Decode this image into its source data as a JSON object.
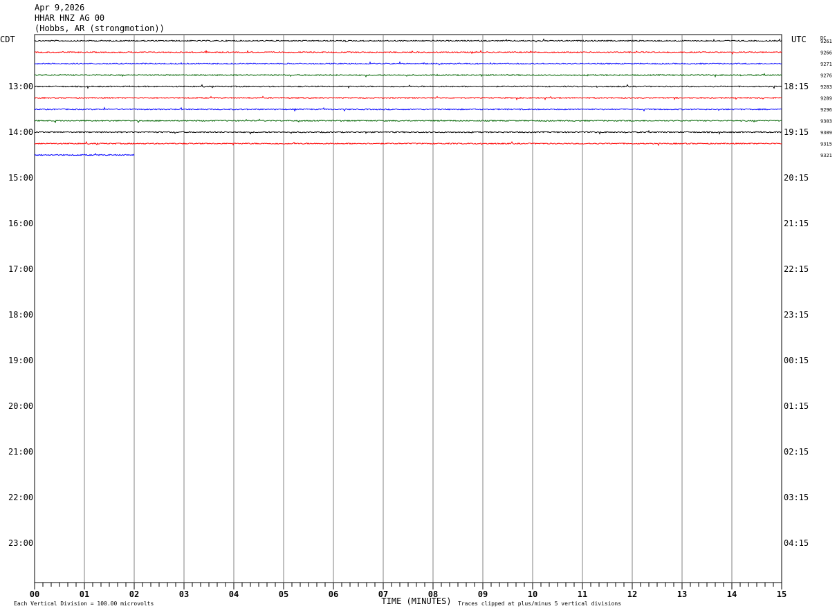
{
  "header": {
    "date": "Apr 9,2026",
    "station": "HHAR HNZ AG 00",
    "location": "(Hobbs, AR (strongmotion))"
  },
  "chart_data": {
    "type": "line",
    "left_axis_label": "CDT",
    "right_axis_label": "UTC",
    "dc_label": "DC",
    "xlabel": "TIME (MINUTES)",
    "xlim": [
      0,
      15
    ],
    "x_tick_labels": [
      "00",
      "01",
      "02",
      "03",
      "04",
      "05",
      "06",
      "07",
      "08",
      "09",
      "10",
      "11",
      "12",
      "13",
      "14",
      "15"
    ],
    "left_hour_labels": [
      "13:00",
      "14:00",
      "15:00",
      "16:00",
      "17:00",
      "18:00",
      "19:00",
      "20:00",
      "21:00",
      "22:00",
      "23:00"
    ],
    "right_hour_labels": [
      "18:15",
      "19:15",
      "20:15",
      "21:15",
      "22:15",
      "23:15",
      "00:15",
      "01:15",
      "02:15",
      "03:15",
      "04:15"
    ],
    "trace_colors": [
      "#000000",
      "#ff0000",
      "#0000ff",
      "#006400"
    ],
    "traces": [
      {
        "dc": "9261",
        "minutes": 15
      },
      {
        "dc": "9266",
        "minutes": 15
      },
      {
        "dc": "9271",
        "minutes": 15
      },
      {
        "dc": "9276",
        "minutes": 15
      },
      {
        "dc": "9283",
        "minutes": 15
      },
      {
        "dc": "9289",
        "minutes": 15
      },
      {
        "dc": "9296",
        "minutes": 15
      },
      {
        "dc": "9303",
        "minutes": 15
      },
      {
        "dc": "9309",
        "minutes": 15
      },
      {
        "dc": "9315",
        "minutes": 15
      },
      {
        "dc": "9321",
        "minutes": 2
      }
    ],
    "footer_left": "Each Vertical Division =  100.00 microvolts",
    "footer_right": "Traces clipped at plus/minus 5 vertical divisions"
  }
}
